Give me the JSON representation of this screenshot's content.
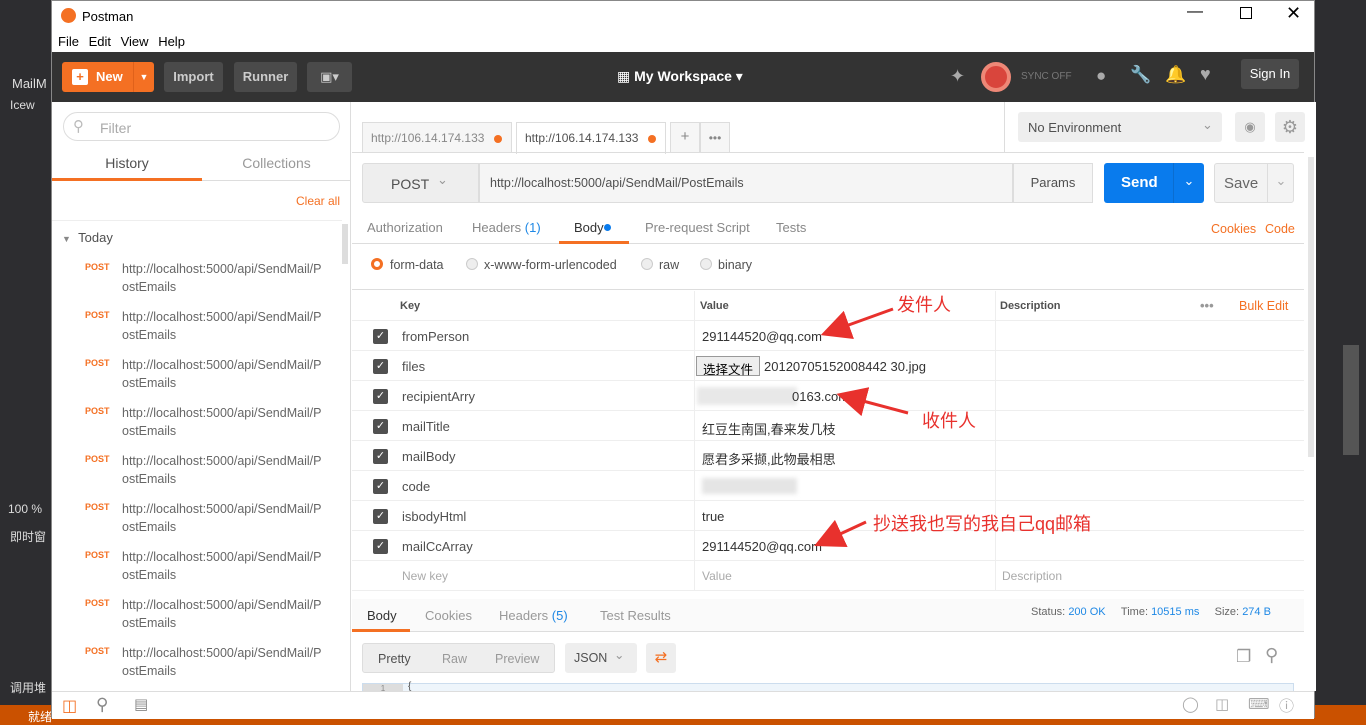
{
  "app": {
    "title": "Postman",
    "menu": [
      "File",
      "Edit",
      "View",
      "Help"
    ]
  },
  "ide": {
    "left_labels": [
      "MailM",
      "Icew",
      "100 %",
      "即时窗",
      "调用堆"
    ],
    "status": "就绪"
  },
  "toolbar": {
    "new": "New",
    "import": "Import",
    "runner": "Runner",
    "workspace": "My Workspace",
    "sync": "SYNC OFF",
    "sign_in": "Sign In"
  },
  "sidebar": {
    "filter_placeholder": "Filter",
    "tabs": [
      "History",
      "Collections"
    ],
    "clear_all": "Clear all",
    "group": "Today",
    "items": [
      {
        "method": "POST",
        "url": "http://localhost:5000/api/SendMail/PostEmails"
      },
      {
        "method": "POST",
        "url": "http://localhost:5000/api/SendMail/PostEmails"
      },
      {
        "method": "POST",
        "url": "http://localhost:5000/api/SendMail/PostEmails"
      },
      {
        "method": "POST",
        "url": "http://localhost:5000/api/SendMail/PostEmails"
      },
      {
        "method": "POST",
        "url": "http://localhost:5000/api/SendMail/PostEmails"
      },
      {
        "method": "POST",
        "url": "http://localhost:5000/api/SendMail/PostEmails"
      },
      {
        "method": "POST",
        "url": "http://localhost:5000/api/SendMail/PostEmails"
      },
      {
        "method": "POST",
        "url": "http://localhost:5000/api/SendMail/PostEmails"
      },
      {
        "method": "POST",
        "url": "http://localhost:5000/api/SendMail/PostEmails"
      }
    ]
  },
  "tabs": [
    {
      "label": "http://106.14.174.133"
    },
    {
      "label": "http://106.14.174.133"
    }
  ],
  "environment": "No Environment",
  "request": {
    "method": "POST",
    "url": "http://localhost:5000/api/SendMail/PostEmails",
    "params": "Params",
    "send": "Send",
    "save": "Save"
  },
  "req_tabs": {
    "authorization": "Authorization",
    "headers": "Headers",
    "headers_count": "(1)",
    "body": "Body",
    "prerequest": "Pre-request Script",
    "tests": "Tests",
    "cookies": "Cookies",
    "code": "Code"
  },
  "body_modes": [
    "form-data",
    "x-www-form-urlencoded",
    "raw",
    "binary"
  ],
  "table": {
    "headers": [
      "Key",
      "Value",
      "Description"
    ],
    "bulk_edit": "Bulk Edit",
    "rows": [
      {
        "key": "fromPerson",
        "value": "291144520@qq.com"
      },
      {
        "key": "files",
        "value": "20120705152008442 30.jpg",
        "button": "选择文件"
      },
      {
        "key": "recipientArry",
        "value": "0163.com"
      },
      {
        "key": "mailTitle",
        "value": "红豆生南国,春来发几枝"
      },
      {
        "key": "mailBody",
        "value": "愿君多采撷,此物最相思"
      },
      {
        "key": "code",
        "value": ""
      },
      {
        "key": "isbodyHtml",
        "value": "true"
      },
      {
        "key": "mailCcArray",
        "value": "291144520@qq.com"
      }
    ],
    "new_key": "New key",
    "new_value": "Value",
    "new_desc": "Description"
  },
  "annotations": [
    "发件人",
    "收件人",
    "抄送我也写的我自己qq邮箱"
  ],
  "response": {
    "tabs": [
      "Body",
      "Cookies",
      "Headers",
      "Test Results"
    ],
    "headers_count": "(5)",
    "status_label": "Status:",
    "status": "200 OK",
    "time_label": "Time:",
    "time": "10515 ms",
    "size_label": "Size:",
    "size": "274 B",
    "views": [
      "Pretty",
      "Raw",
      "Preview"
    ],
    "format": "JSON",
    "line": "1",
    "code": "{"
  },
  "colors": {
    "accent": "#f47023",
    "send": "#097bed",
    "link": "#1e88e5"
  }
}
